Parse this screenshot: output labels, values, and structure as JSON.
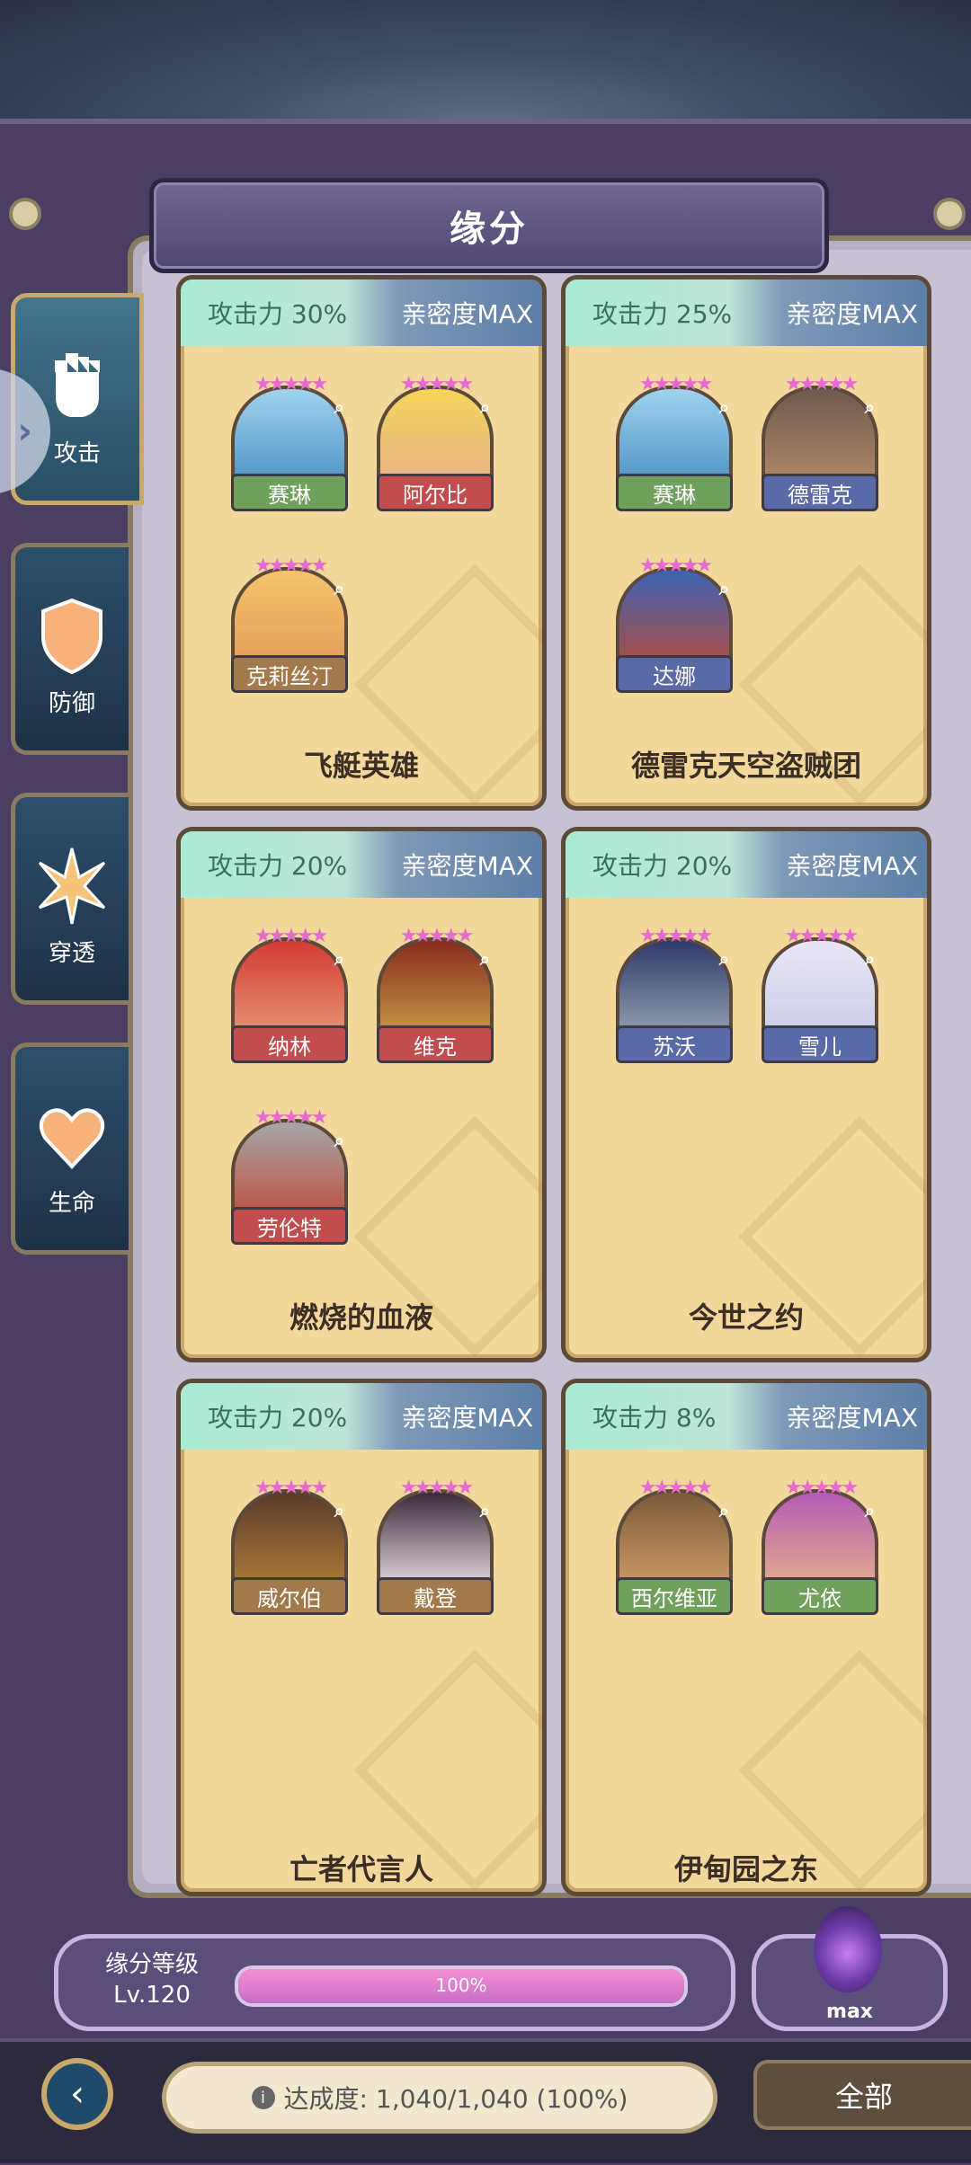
{
  "header": {
    "title": "缘分"
  },
  "tabs": [
    {
      "label": "攻击",
      "icon": "fist-icon",
      "active": true
    },
    {
      "label": "防御",
      "icon": "shield-icon",
      "active": false
    },
    {
      "label": "穿透",
      "icon": "burst-icon",
      "active": false
    },
    {
      "label": "生命",
      "icon": "heart-icon",
      "active": false
    }
  ],
  "cards": [
    {
      "stat": "攻击力 30%",
      "bond": "亲密度MAX",
      "name": "飞艇英雄",
      "heroes": [
        {
          "name": "赛琳",
          "color": "green"
        },
        {
          "name": "阿尔比",
          "color": "red"
        },
        {
          "name": "克莉丝汀",
          "color": "brown"
        }
      ]
    },
    {
      "stat": "攻击力 25%",
      "bond": "亲密度MAX",
      "name": "德雷克天空盗贼团",
      "heroes": [
        {
          "name": "赛琳",
          "color": "green"
        },
        {
          "name": "德雷克",
          "color": "blue"
        },
        {
          "name": "达娜",
          "color": "blue"
        }
      ]
    },
    {
      "stat": "攻击力 20%",
      "bond": "亲密度MAX",
      "name": "燃烧的血液",
      "heroes": [
        {
          "name": "纳林",
          "color": "red"
        },
        {
          "name": "维克",
          "color": "red"
        },
        {
          "name": "劳伦特",
          "color": "red"
        }
      ]
    },
    {
      "stat": "攻击力 20%",
      "bond": "亲密度MAX",
      "name": "今世之约",
      "heroes": [
        {
          "name": "苏沃",
          "color": "blue"
        },
        {
          "name": "雪儿",
          "color": "blue"
        }
      ]
    },
    {
      "stat": "攻击力 20%",
      "bond": "亲密度MAX",
      "name": "亡者代言人",
      "heroes": [
        {
          "name": "威尔伯",
          "color": "brown"
        },
        {
          "name": "戴登",
          "color": "brown"
        }
      ]
    },
    {
      "stat": "攻击力 8%",
      "bond": "亲密度MAX",
      "name": "伊甸园之东",
      "heroes": [
        {
          "name": "西尔维亚",
          "color": "green"
        },
        {
          "name": "尤依",
          "color": "green"
        }
      ]
    }
  ],
  "level": {
    "label": "缘分等级",
    "value": "Lv.120",
    "progress_text": "100%",
    "progress": 1.0
  },
  "max_button": {
    "label": "max"
  },
  "footer": {
    "achievement": "达成度: 1,040/1,040 (100%)",
    "filter_label": "全部",
    "back_icon": "back-arrow-icon",
    "info_icon": "info-icon"
  },
  "colors": {
    "accent": "#e76ad0",
    "panel": "#f2d89a",
    "frame": "#4a3f63"
  }
}
